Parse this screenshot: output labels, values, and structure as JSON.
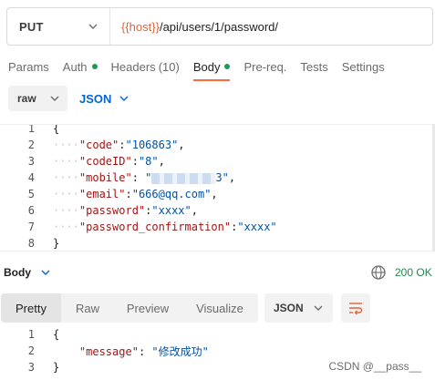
{
  "request": {
    "method": "PUT",
    "url_var": "{{host}}",
    "url_path": "/api/users/1/password/"
  },
  "tabs": [
    {
      "label": "Params"
    },
    {
      "label": "Auth"
    },
    {
      "label": "Headers",
      "count": "(10)"
    },
    {
      "label": "Body"
    },
    {
      "label": "Pre-req."
    },
    {
      "label": "Tests"
    },
    {
      "label": "Settings"
    }
  ],
  "body_mode": {
    "type": "raw",
    "language": "JSON"
  },
  "request_body": {
    "line_numbers": [
      "1",
      "2",
      "3",
      "4",
      "5",
      "6",
      "7",
      "8"
    ],
    "open": "{",
    "close": "}",
    "dots": "····",
    "fields": [
      {
        "key": "\"code\"",
        "value": "\"106863\"",
        "suffix": ","
      },
      {
        "key": "\"codeID\"",
        "value": "\"8\"",
        "suffix": ","
      },
      {
        "key": "\"mobile\"",
        "value_prefix": "\"",
        "value_suffix": "3\"",
        "suffix": ","
      },
      {
        "key": "\"email\"",
        "value": "\"666@qq.com\"",
        "suffix": ","
      },
      {
        "key": "\"password\"",
        "value": "\"xxxx\"",
        "suffix": ","
      },
      {
        "key": "\"password_confirmation\"",
        "value": "\"xxxx\"",
        "suffix": ""
      }
    ]
  },
  "response": {
    "title": "Body",
    "status": "200 OK",
    "views": [
      "Pretty",
      "Raw",
      "Preview",
      "Visualize"
    ],
    "format": "JSON",
    "line_numbers": [
      "1",
      "2",
      "3"
    ],
    "open": "{",
    "close": "}",
    "key": "\"message\"",
    "value": "\"修改成功\""
  },
  "watermark": "CSDN @__pass__"
}
